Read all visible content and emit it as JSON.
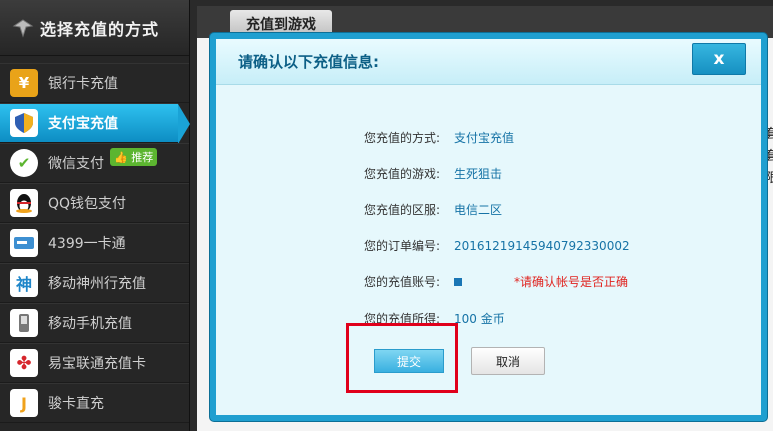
{
  "sidebar": {
    "title": "选择充值的方式",
    "items": [
      {
        "label": "银行卡充值",
        "icon": "yen-icon",
        "glyph": "¥",
        "color": "#e9a319"
      },
      {
        "label": "支付宝充值",
        "icon": "alipay-shield-icon",
        "glyph": "◆",
        "color": "#2f5fb3"
      },
      {
        "label": "微信支付",
        "icon": "wechat-icon",
        "glyph": "✔",
        "color": "#5cb530",
        "badge": "推荐"
      },
      {
        "label": "QQ钱包支付",
        "icon": "qq-penguin-icon",
        "glyph": "●",
        "color": "#111111"
      },
      {
        "label": "4399一卡通",
        "icon": "card-icon",
        "glyph": "▭",
        "color": "#3d8fd1"
      },
      {
        "label": "移动神州行充值",
        "icon": "shen-icon",
        "glyph": "神",
        "color": "#1f86c9"
      },
      {
        "label": "移动手机充值",
        "icon": "phone-icon",
        "glyph": "▮",
        "color": "#888888"
      },
      {
        "label": "易宝联通充值卡",
        "icon": "unicom-icon",
        "glyph": "✤",
        "color": "#d6262c"
      },
      {
        "label": "骏卡直充",
        "icon": "junka-icon",
        "glyph": "J",
        "color": "#f0a21c"
      }
    ]
  },
  "background": {
    "tab_label": "充值到游戏",
    "edge_chars": "套\n套\n限"
  },
  "dialog": {
    "title": "请确认以下充值信息:",
    "close_label": "x",
    "rows": {
      "method": {
        "label": "您充值的方式:",
        "value": "支付宝充值"
      },
      "game": {
        "label": "您充值的游戏:",
        "value": "生死狙击"
      },
      "server": {
        "label": "您充值的区服:",
        "value": "电信二区"
      },
      "order": {
        "label": "您的订单编号:",
        "value": "20161219145940792330002"
      },
      "account": {
        "label": "您的充值账号:",
        "warning": "*请确认帐号是否正确"
      },
      "reward": {
        "label": "您的充值所得:",
        "value": "100 金币"
      }
    },
    "submit_label": "提交",
    "cancel_label": "取消"
  },
  "colors": {
    "accent": "#1f9fd0",
    "warning": "#e0231f",
    "highlight": "#e0001b"
  }
}
